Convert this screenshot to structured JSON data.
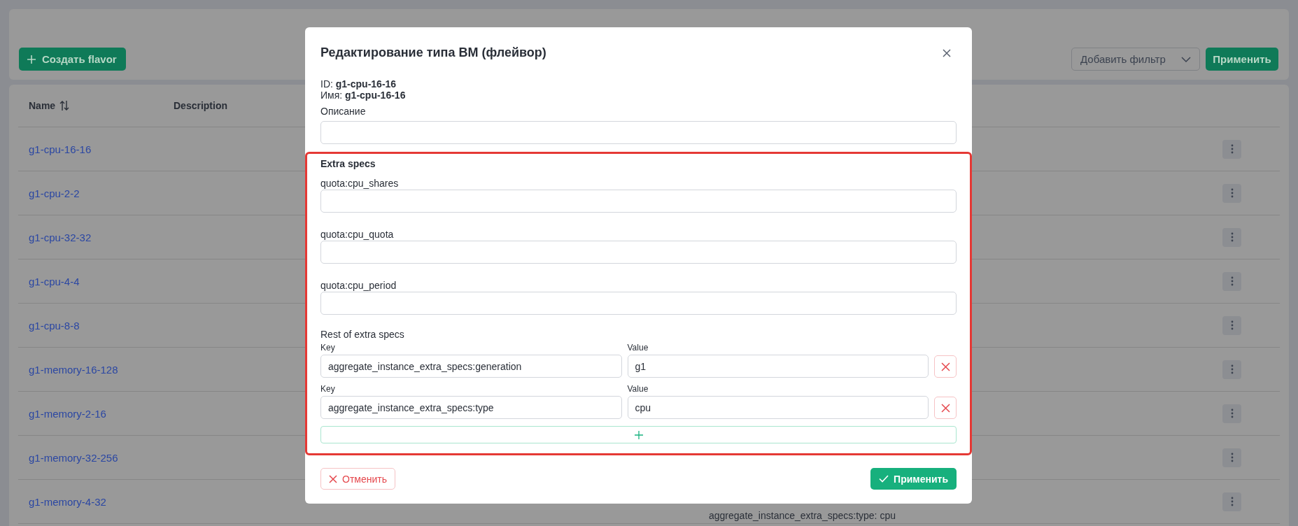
{
  "toolbar": {
    "create_button": "Создать flavor",
    "filter_select": {
      "placeholder": "Добавить фильтр"
    },
    "apply_button": "Применить"
  },
  "table": {
    "columns": [
      {
        "label": "Name",
        "sortable": true
      },
      {
        "label": "Description",
        "sortable": false
      }
    ],
    "rows": [
      {
        "name": "g1-cpu-16-16"
      },
      {
        "name": "g1-cpu-2-2"
      },
      {
        "name": "g1-cpu-32-32"
      },
      {
        "name": "g1-cpu-4-4"
      },
      {
        "name": "g1-cpu-8-8"
      },
      {
        "name": "g1-memory-16-128"
      },
      {
        "name": "g1-memory-2-16"
      },
      {
        "name": "g1-memory-32-256"
      },
      {
        "name": "g1-memory-4-32",
        "column_4": "aggregate_instance_extra_specs:type: cpu"
      }
    ]
  },
  "modal": {
    "title": "Редактирование типа ВМ (флейвор)",
    "id_line": "ID: **g1-cpu-16-16**",
    "name_line": "Имя: **g1-cpu-16-16**",
    "description": {
      "label": "Описание"
    },
    "extra_specs": {
      "title": "Extra specs",
      "highlighted": true,
      "fields": [
        {
          "label": "quota:cpu_shares"
        },
        {
          "label": "quota:cpu_quota"
        },
        {
          "label": "quota:cpu_period"
        }
      ],
      "rest_title": "Rest of extra specs",
      "pairs": [
        {
          "key_label": "Key",
          "key": "aggregate_instance_extra_specs:generation",
          "value_label": "Value",
          "value": "g1"
        },
        {
          "key_label": "Key",
          "key": "aggregate_instance_extra_specs:type",
          "value_label": "Value",
          "value": "cpu"
        }
      ]
    },
    "cancel_button": "Отменить",
    "submit_button": "Применить"
  }
}
